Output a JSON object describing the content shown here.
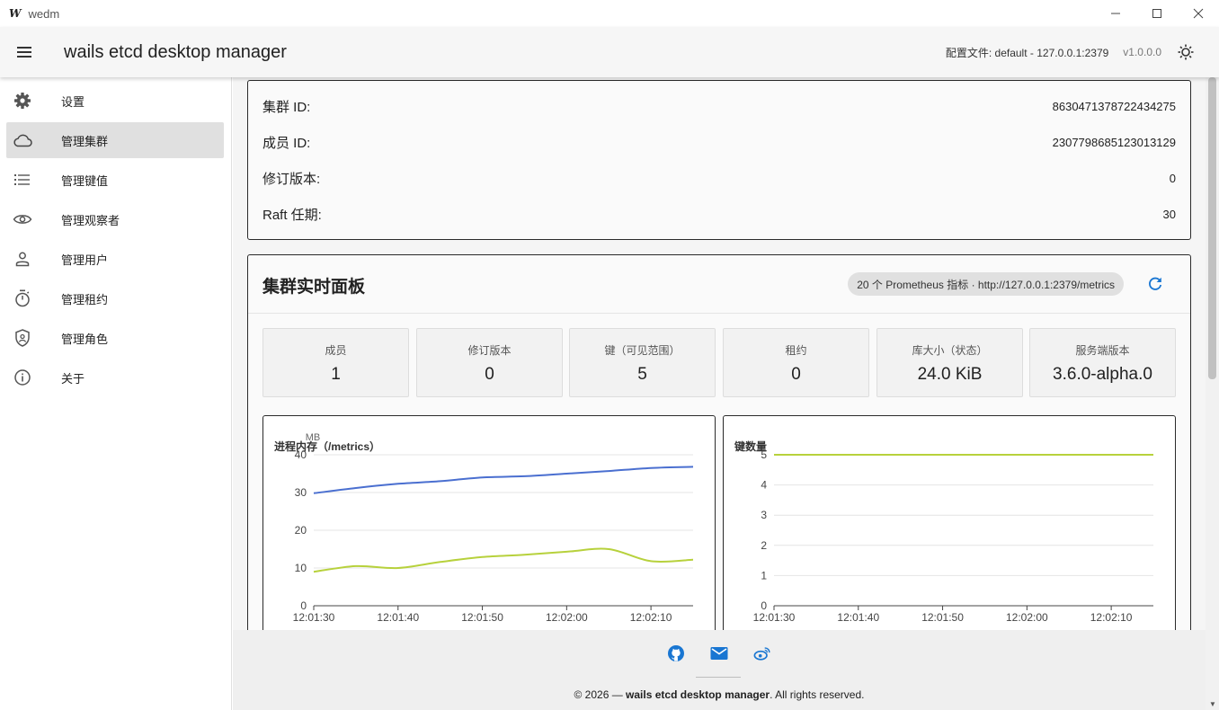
{
  "window": {
    "logo": "W",
    "title": "wedm",
    "minimize": "—",
    "maximize": "☐",
    "close": "✕"
  },
  "appbar": {
    "title": "wails etcd desktop manager",
    "profile": "配置文件: default - 127.0.0.1:2379",
    "version": "v1.0.0.0"
  },
  "sidebar": {
    "items": [
      {
        "label": "设置",
        "icon": "gear-icon"
      },
      {
        "label": "管理集群",
        "icon": "cloud-icon"
      },
      {
        "label": "管理键值",
        "icon": "list-icon"
      },
      {
        "label": "管理观察者",
        "icon": "eye-icon"
      },
      {
        "label": "管理用户",
        "icon": "user-icon"
      },
      {
        "label": "管理租约",
        "icon": "timer-icon"
      },
      {
        "label": "管理角色",
        "icon": "shield-icon"
      },
      {
        "label": "关于",
        "icon": "info-icon"
      }
    ],
    "active_index": 1
  },
  "cluster_info": {
    "rows": [
      {
        "key": "集群 ID:",
        "value": "8630471378722434275"
      },
      {
        "key": "成员 ID:",
        "value": "2307798685123013129"
      },
      {
        "key": "修订版本:",
        "value": "0"
      },
      {
        "key": "Raft 任期:",
        "value": "30"
      }
    ]
  },
  "dashboard": {
    "title": "集群实时面板",
    "chip": "20 个 Prometheus 指标 · http://127.0.0.1:2379/metrics",
    "stats": [
      {
        "label": "成员",
        "value": "1"
      },
      {
        "label": "修订版本",
        "value": "0"
      },
      {
        "label": "键（可见范围）",
        "value": "5"
      },
      {
        "label": "租约",
        "value": "0"
      },
      {
        "label": "库大小（状态）",
        "value": "24.0 KiB"
      },
      {
        "label": "服务端版本",
        "value": "3.6.0-alpha.0"
      }
    ]
  },
  "chart_data": [
    {
      "type": "line",
      "title": "进程内存（/metrics）",
      "ylabel": "MB",
      "x": [
        "12:01:30",
        "12:01:35",
        "12:01:40",
        "12:01:45",
        "12:01:50",
        "12:01:55",
        "12:02:00",
        "12:02:05",
        "12:02:10",
        "12:02:15"
      ],
      "xticks": [
        "12:01:30",
        "12:01:40",
        "12:01:50",
        "12:02:00",
        "12:02:10"
      ],
      "yticks": [
        0,
        10,
        20,
        30,
        40
      ],
      "ylim": [
        0,
        40
      ],
      "grid": true,
      "series": [
        {
          "color": "#4a6fd0",
          "values": [
            29.8,
            31.2,
            32.3,
            33.0,
            34.0,
            34.3,
            35.0,
            35.7,
            36.5,
            36.8
          ]
        },
        {
          "color": "#b7d13c",
          "values": [
            9.0,
            10.5,
            10.0,
            11.6,
            12.9,
            13.5,
            14.3,
            15.0,
            11.8,
            12.2
          ]
        }
      ]
    },
    {
      "type": "line",
      "title": "键数量",
      "x": [
        "12:01:30",
        "12:01:35",
        "12:01:40",
        "12:01:45",
        "12:01:50",
        "12:01:55",
        "12:02:00",
        "12:02:05",
        "12:02:10",
        "12:02:15"
      ],
      "xticks": [
        "12:01:30",
        "12:01:40",
        "12:01:50",
        "12:02:00",
        "12:02:10"
      ],
      "yticks": [
        0,
        1,
        2,
        3,
        4,
        5
      ],
      "ylim": [
        0,
        5
      ],
      "grid": true,
      "series": [
        {
          "color": "#b7d13c",
          "values": [
            5,
            5,
            5,
            5,
            5,
            5,
            5,
            5,
            5,
            5
          ]
        }
      ]
    }
  ],
  "footer": {
    "icons": [
      "github-icon",
      "mail-icon",
      "weibo-icon"
    ],
    "copy_prefix": "© 2026 — ",
    "copy_brand": "wails etcd desktop manager",
    "copy_suffix": ". All rights reserved."
  },
  "colors": {
    "accent": "#1976d2",
    "active_nav": "#e0e0e0",
    "series_blue": "#4a6fd0",
    "series_green": "#b7d13c"
  }
}
